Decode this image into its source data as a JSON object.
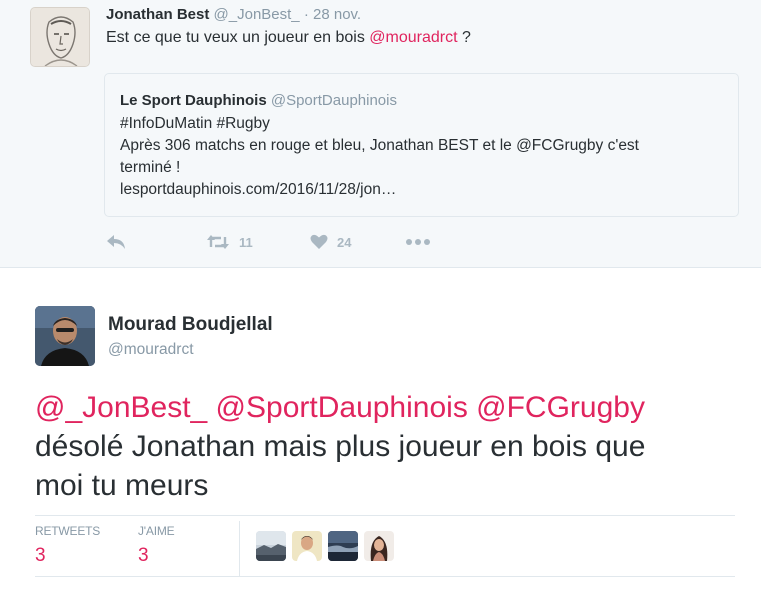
{
  "parent_tweet": {
    "author_name": "Jonathan Best",
    "author_handle": "@_JonBest_",
    "separator": "·",
    "date": "28 nov.",
    "text_prefix": "Est ce que tu veux un joueur en bois ",
    "text_mention": "@mouradrct",
    "text_suffix": " ?",
    "quoted": {
      "author_name": "Le Sport Dauphinois",
      "author_handle": "@SportDauphinois",
      "lines": [
        "#InfoDuMatin #Rugby",
        "Après 306 matchs en rouge et bleu, Jonathan BEST et le @FCGrugby c'est",
        "terminé !",
        "lesportdauphinois.com/2016/11/28/jon…"
      ]
    },
    "actions": {
      "reply_icon": "reply-icon",
      "retweet_icon": "retweet-icon",
      "retweet_count": "11",
      "like_icon": "heart-icon",
      "like_count": "24",
      "more_icon": "more-dots-icon"
    }
  },
  "main_tweet": {
    "author_name": "Mourad Boudjellal",
    "author_handle": "@mouradrct",
    "mentions": "@_JonBest_ @SportDauphinois @FCGrugby",
    "text_line1": "désolé Jonathan mais plus joueur en bois que",
    "text_line2": "moi tu meurs",
    "stats": {
      "retweets_label": "RETWEETS",
      "retweets_value": "3",
      "likes_label": "J'AIME",
      "likes_value": "3"
    }
  },
  "colors": {
    "accent": "#e0245e",
    "muted": "#8899a6",
    "text": "#292f33",
    "parent_bg": "#f5f8fa"
  }
}
